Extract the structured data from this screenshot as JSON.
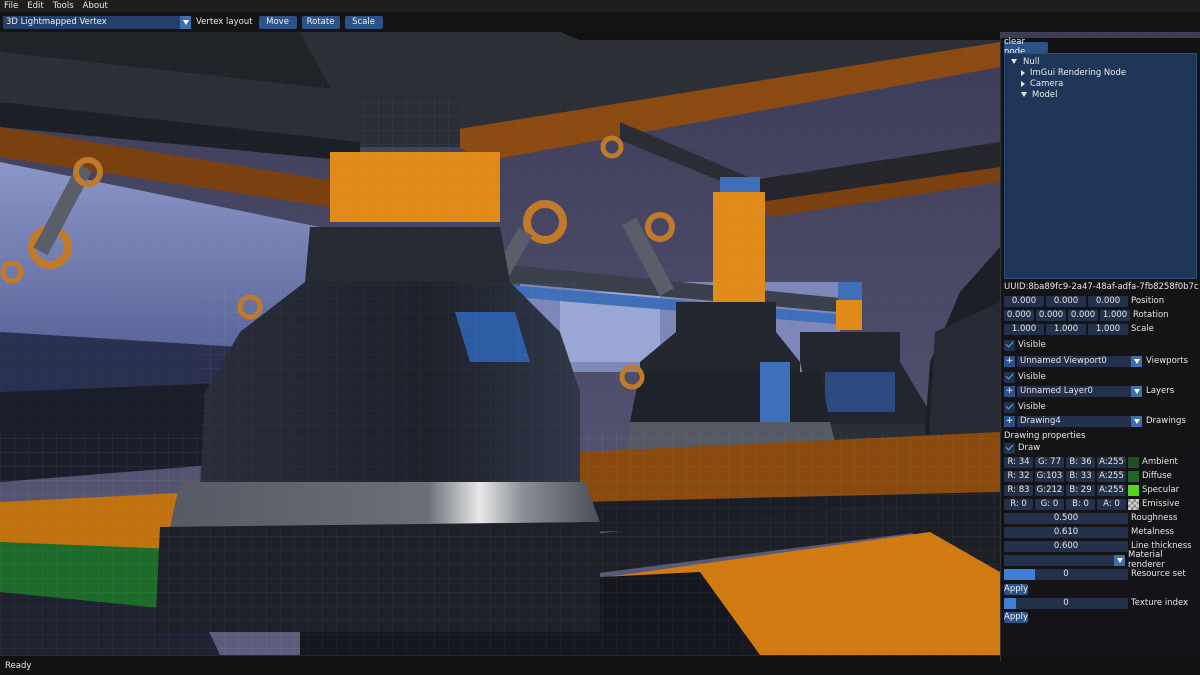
{
  "menu": {
    "items": [
      "File",
      "Edit",
      "Tools",
      "About"
    ]
  },
  "toolbar": {
    "layout_value": "3D Lightmapped Vertex",
    "layout_label": "Vertex layout",
    "move_label": "Move",
    "rotate_label": "Rotate",
    "scale_label": "Scale"
  },
  "status": {
    "text": "Ready"
  },
  "panel": {
    "clear_node_label": "clear node",
    "tree": {
      "root": "Null",
      "children": [
        "ImGui Rendering Node",
        "Camera",
        "Model"
      ]
    },
    "uuid": "UUID:8ba89fc9-2a47-48af-adfa-7fb8258f0b7c",
    "transform": {
      "position": {
        "label": "Position",
        "values": [
          "0.000",
          "0.000",
          "0.000"
        ]
      },
      "rotation": {
        "label": "Rotation",
        "values": [
          "0.000",
          "0.000",
          "0.000",
          "1.000"
        ]
      },
      "scale": {
        "label": "Scale",
        "values": [
          "1.000",
          "1.000",
          "1.000"
        ]
      }
    },
    "visible_label": "Visible",
    "viewports": {
      "value": "Unnamed Viewport0",
      "label": "Viewports"
    },
    "layers": {
      "value": "Unnamed Layer0",
      "label": "Layers"
    },
    "drawings": {
      "value": "Drawing4",
      "label": "Drawings"
    },
    "drawing_properties_label": "Drawing properties",
    "draw_label": "Draw",
    "colors": {
      "ambient": {
        "r": "R: 34",
        "g": "G: 77",
        "b": "B: 36",
        "a": "A:255",
        "label": "Ambient",
        "swatch": "#224d24"
      },
      "diffuse": {
        "r": "R: 32",
        "g": "G:103",
        "b": "B: 33",
        "a": "A:255",
        "label": "Diffuse",
        "swatch": "#206721"
      },
      "specular": {
        "r": "R: 83",
        "g": "G:212",
        "b": "B: 29",
        "a": "A:255",
        "label": "Specular",
        "swatch": "#53d41d"
      },
      "emissive": {
        "r": "R: 0",
        "g": "G: 0",
        "b": "B: 0",
        "a": "A: 0",
        "label": "Emissive",
        "swatch": "checker"
      }
    },
    "roughness": {
      "value": "0.500",
      "label": "Roughness"
    },
    "metalness": {
      "value": "0.610",
      "label": "Metalness"
    },
    "line_thickness": {
      "value": "0.600",
      "label": "Line thickness"
    },
    "material_renderer": {
      "label": "Material renderer"
    },
    "resource_set": {
      "value": "0",
      "label": "Resource set",
      "fill": 0.25
    },
    "texture_index": {
      "value": "0",
      "label": "Texture index",
      "fill": 0.1
    },
    "apply_label": "Apply"
  }
}
